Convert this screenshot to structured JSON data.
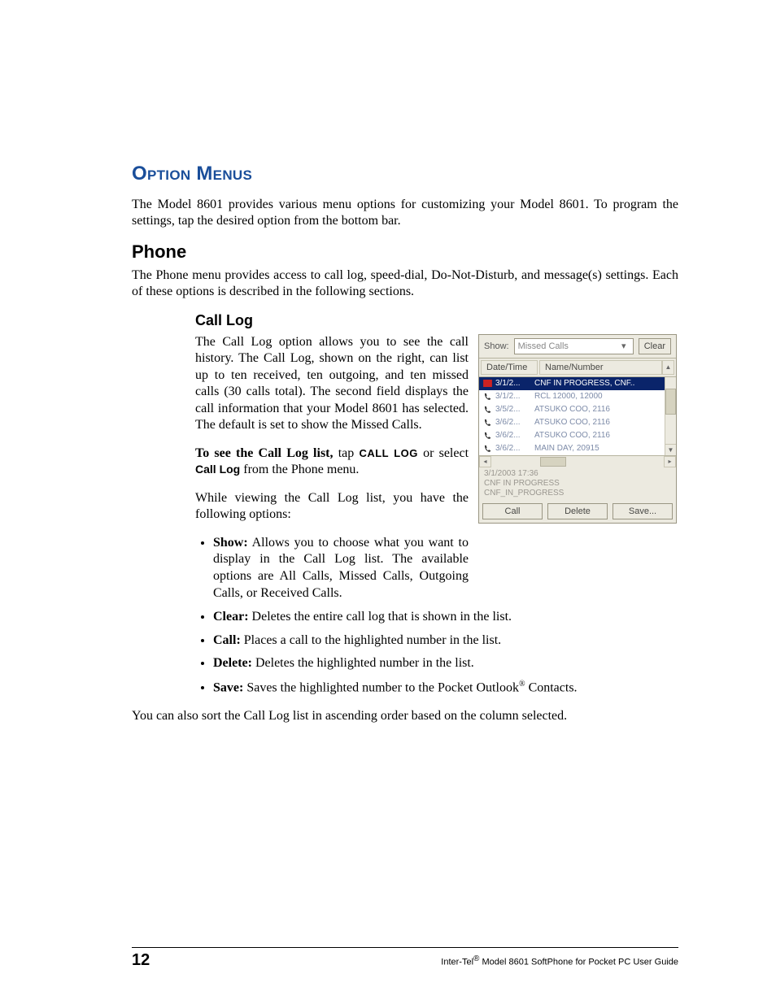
{
  "headings": {
    "h1": "Option Menus",
    "h2": "Phone",
    "h3": "Call Log"
  },
  "paragraphs": {
    "intro": "The Model 8601 provides various menu options for customizing your Model 8601. To program the settings, tap the desired option from the bottom bar.",
    "phone_intro": "The Phone menu provides access to call log, speed-dial, Do-Not-Disturb, and message(s) settings. Each of these options is described in the following sections.",
    "calllog_p1": "The Call Log option allows you to see the call history. The Call Log, shown on the right, can list up to ten received, ten outgoing, and ten missed calls (30 calls total). The second field displays the call information that your Model 8601 has selected. The default is set to show the Missed Calls.",
    "calllog_cmd_pre": "To see the Call Log list,",
    "calllog_cmd_mid": " tap ",
    "calllog_cmd_code": "CALL LOG",
    "calllog_cmd_post1": " or select ",
    "calllog_cmd_bold": "Call Log",
    "calllog_cmd_post2": " from the Phone menu.",
    "calllog_p3": "While viewing the Call Log list, you have the following options:",
    "sort_note": "You can also sort the Call Log list in ascending order based on the column selected."
  },
  "bullets": {
    "show": {
      "label": "Show:",
      "text": " Allows you to choose what you want to display in the Call Log list. The available options are All Calls, Missed Calls, Outgoing Calls, or Received Calls."
    },
    "clear": {
      "label": "Clear:",
      "text": " Deletes the entire call log that is shown in the list."
    },
    "call": {
      "label": "Call:",
      "text": " Places a call to the highlighted number in the list."
    },
    "delete": {
      "label": "Delete:",
      "text": " Deletes the highlighted number in the list."
    },
    "save": {
      "label": "Save:",
      "text_pre": " Saves the highlighted number to the Pocket Outlook",
      "reg": "®",
      "text_post": " Contacts."
    }
  },
  "screenshot": {
    "show_label": "Show:",
    "show_value": "Missed Calls",
    "clear_btn": "Clear",
    "headers": {
      "date": "Date/Time",
      "name": "Name/Number"
    },
    "rows": [
      {
        "icon": "missed",
        "date": "3/1/2...",
        "name": "CNF IN PROGRESS, CNF..",
        "selected": true
      },
      {
        "icon": "phone",
        "date": "3/1/2...",
        "name": "RCL 12000, 12000"
      },
      {
        "icon": "phone",
        "date": "3/5/2...",
        "name": "ATSUKO COO, 2116"
      },
      {
        "icon": "phone",
        "date": "3/6/2...",
        "name": "ATSUKO COO, 2116"
      },
      {
        "icon": "phone",
        "date": "3/6/2...",
        "name": "ATSUKO COO, 2116"
      },
      {
        "icon": "phone",
        "date": "3/6/2...",
        "name": "MAIN DAY, 20915"
      }
    ],
    "detail_lines": [
      "3/1/2003 17:36",
      "CNF IN PROGRESS",
      "CNF_IN_PROGRESS"
    ],
    "bottom_buttons": {
      "call": "Call",
      "delete": "Delete",
      "save": "Save..."
    }
  },
  "footer": {
    "page": "12",
    "title_pre": "Inter-Tel",
    "title_reg": "®",
    "title_post": " Model 8601 SoftPhone for Pocket PC User Guide"
  }
}
